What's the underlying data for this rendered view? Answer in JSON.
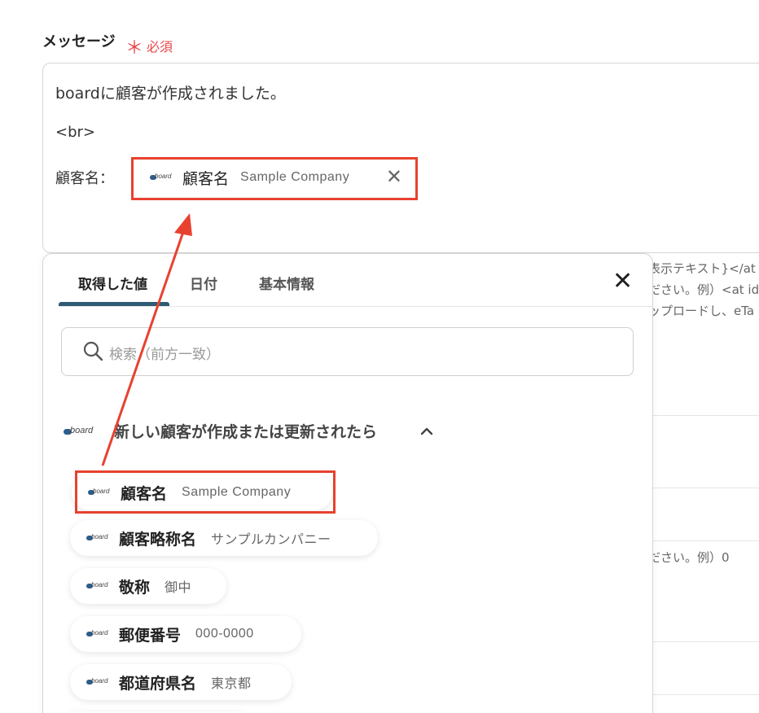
{
  "field": {
    "label": "メッセージ",
    "required_star": "＊",
    "required_text": "必須"
  },
  "message": {
    "line1": "boardに顧客が作成されました。",
    "line2": "<br>",
    "line3_label": "顧客名：",
    "chip": {
      "logo": "board",
      "name": "顧客名",
      "value": "Sample Company"
    }
  },
  "background_hints": [
    "表示テキスト}</at",
    "ださい。例）<at id=",
    "ップロードし、eTa",
    "ださい。例）0"
  ],
  "panel": {
    "tabs": [
      "取得した値",
      "日付",
      "基本情報"
    ],
    "active_tab": 0,
    "search_placeholder": "検索（前方一致）",
    "group": {
      "logo": "board",
      "title": "新しい顧客が作成または更新されたら",
      "expanded": true
    },
    "items": [
      {
        "logo": "board",
        "name": "顧客名",
        "value": "Sample Company",
        "highlighted": true
      },
      {
        "logo": "board",
        "name": "顧客略称名",
        "value": "サンプルカンパニー"
      },
      {
        "logo": "board",
        "name": "敬称",
        "value": "御中"
      },
      {
        "logo": "board",
        "name": "郵便番号",
        "value": "000-0000"
      },
      {
        "logo": "board",
        "name": "都道府県名",
        "value": "東京都"
      }
    ]
  },
  "colors": {
    "highlight": "#e8412f",
    "required": "#e8474a",
    "tab_underline": "#2e5b73"
  }
}
